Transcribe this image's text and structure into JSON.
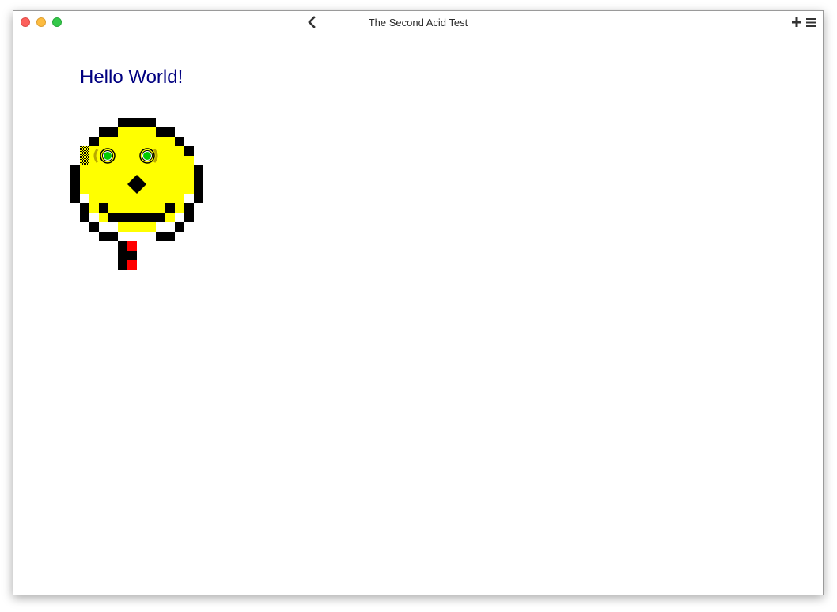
{
  "window": {
    "title": "The Second Acid Test"
  },
  "toolbar": {
    "back_icon": "chevron-left-icon",
    "new_tab_icon": "plus-icon",
    "menu_icon": "hamburger-menu-icon"
  },
  "page": {
    "heading": "Hello World!"
  },
  "colors": {
    "heading": "#000080",
    "face": "#ffff00",
    "outline": "#000000",
    "eyes": "#00cc00",
    "tongue": "#ff0000"
  }
}
